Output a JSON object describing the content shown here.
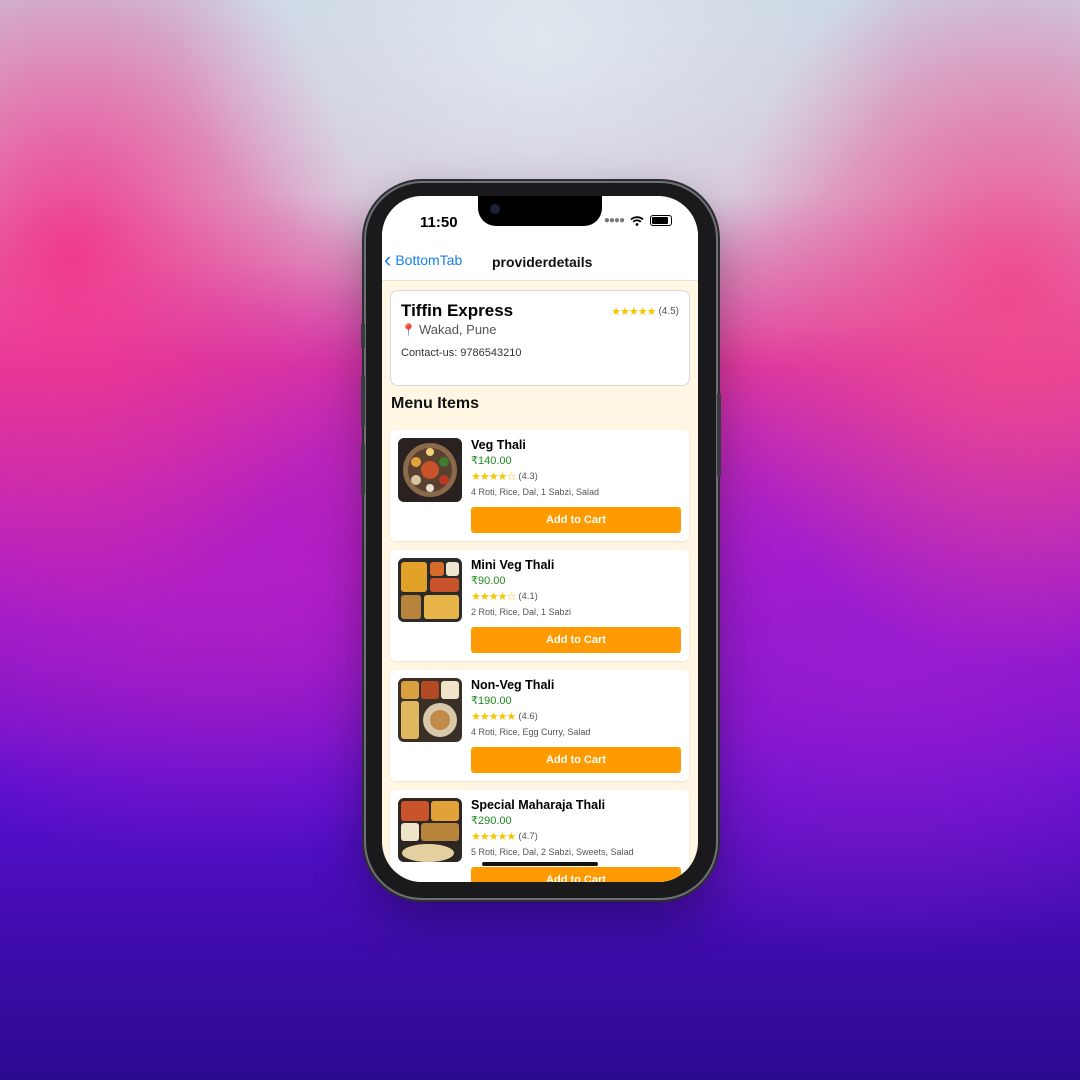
{
  "status_bar": {
    "time": "11:50"
  },
  "navbar": {
    "back_label": "BottomTab",
    "title": "providerdetails"
  },
  "provider": {
    "name": "Tiffin Express",
    "stars": "★★★★★",
    "rating_text": "(4.5)",
    "location": "Wakad, Pune",
    "contact": "Contact-us: 9786543210"
  },
  "section": {
    "title": "Menu Items"
  },
  "menu_items": [
    {
      "name": "Veg Thali",
      "price": "₹140.00",
      "stars": "★★★★☆",
      "rating_text": "(4.3)",
      "description": "4 Roti, Rice, Dal, 1 Sabzi, Salad",
      "button": "Add to Cart"
    },
    {
      "name": "Mini Veg Thali",
      "price": "₹90.00",
      "stars": "★★★★☆",
      "rating_text": "(4.1)",
      "description": "2 Roti, Rice, Dal, 1 Sabzi",
      "button": "Add to Cart"
    },
    {
      "name": "Non-Veg Thali",
      "price": "₹190.00",
      "stars": "★★★★★",
      "rating_text": "(4.6)",
      "description": "4 Roti, Rice, Egg Curry, Salad",
      "button": "Add to Cart"
    },
    {
      "name": "Special Maharaja Thali",
      "price": "₹290.00",
      "stars": "★★★★★",
      "rating_text": "(4.7)",
      "description": "5 Roti, Rice, Dal, 2 Sabzi, Sweets, Salad",
      "button": "Add to Cart"
    }
  ],
  "colors": {
    "accent_button": "#ff9a00",
    "price": "#1f8a1f",
    "link": "#1a7ff0",
    "star": "#f7c500",
    "screen_bg": "#fff6e3"
  }
}
